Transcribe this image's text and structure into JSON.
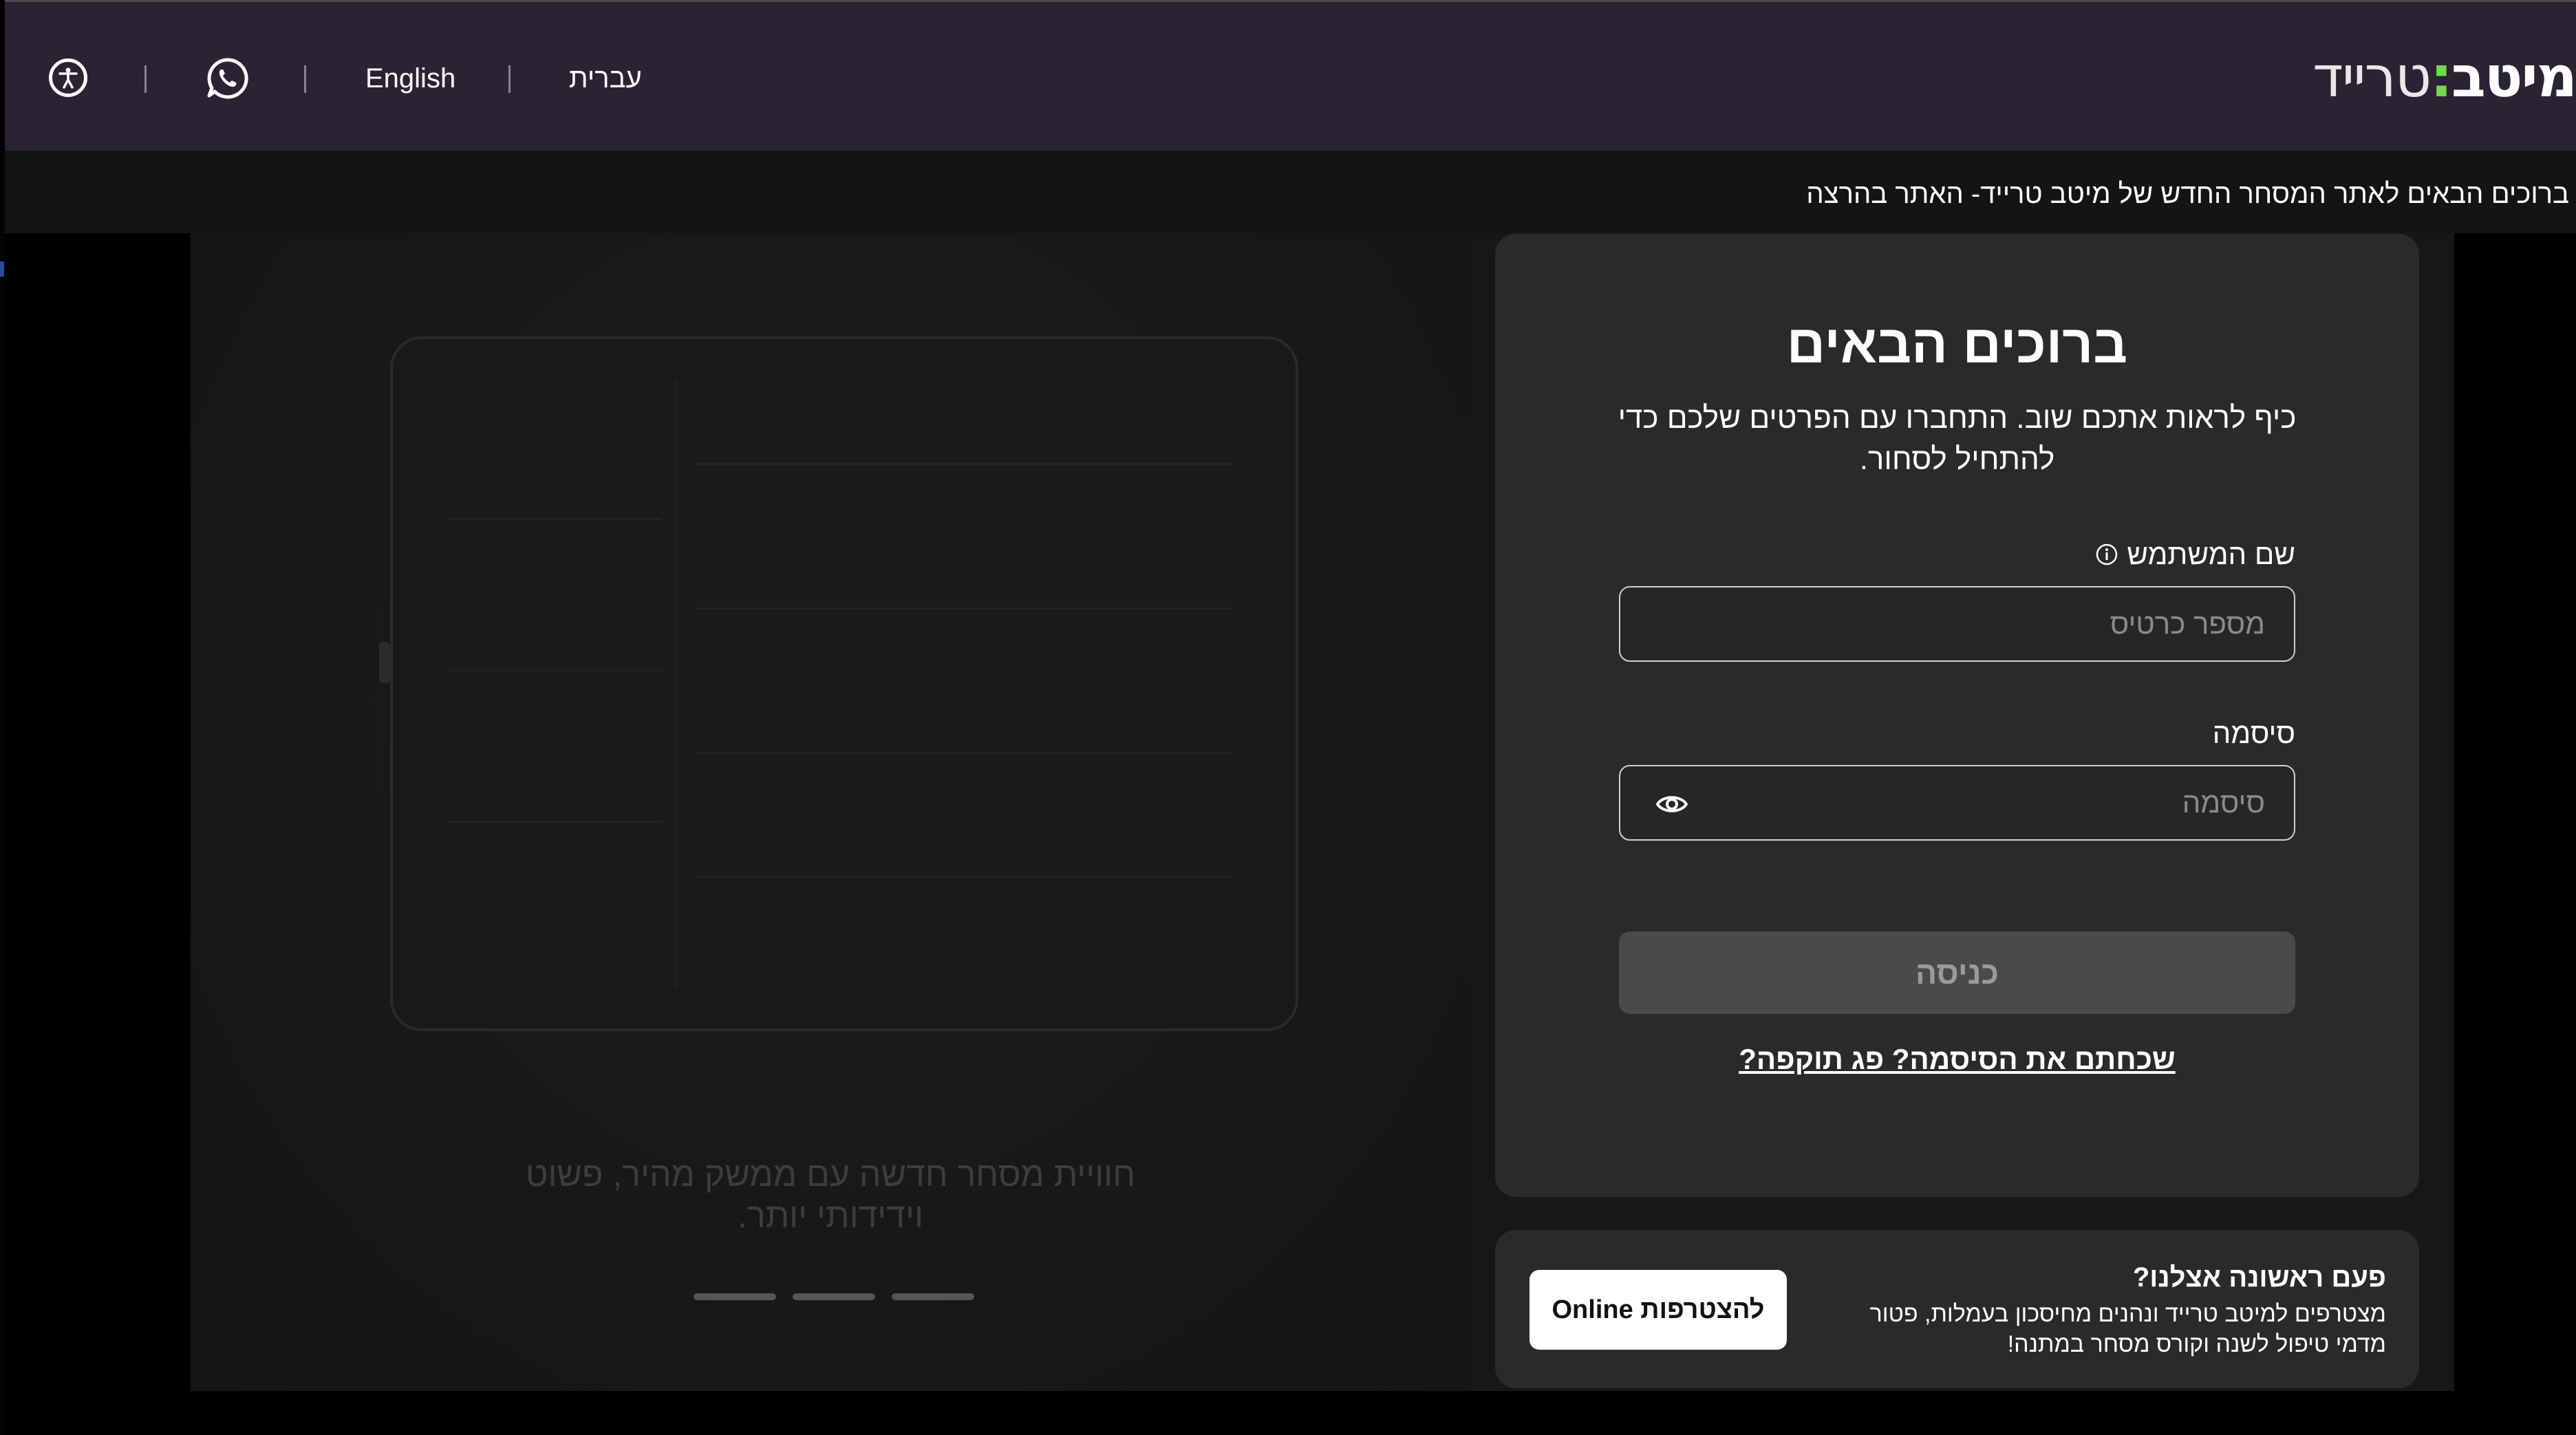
{
  "header": {
    "logo_bold": "מיטב",
    "logo_colon": ":",
    "logo_light": "טרייד",
    "lang_hebrew": "עברית",
    "lang_english": "English",
    "whatsapp_icon": "whatsapp-icon",
    "accessibility_icon": "accessibility-icon"
  },
  "ticker": {
    "text": "ברוכים הבאים לאתר המסחר החדש של מיטב טרייד- האתר בהרצה"
  },
  "hero": {
    "caption": "חוויית מסחר חדשה עם ממשק מהיר, פשוט וידידותי יותר.",
    "slides_count": 3,
    "active_slide": 3
  },
  "login": {
    "title": "ברוכים הבאים",
    "subtitle": "כיף לראות אתכם שוב. התחברו עם הפרטים שלכם כדי להתחיל לסחור.",
    "username_label": "שם המשתמש",
    "username_placeholder": "מספר כרטיס",
    "password_label": "סיסמה",
    "password_placeholder": "סיסמה",
    "submit_label": "כניסה",
    "forgot_link": "שכחתם את הסיסמה? פג תוקפה?"
  },
  "join": {
    "title": "פעם ראשונה אצלנו?",
    "text": "מצטרפים למיטב טרייד ונהנים מחיסכון בעמלות, פטור מדמי טיפול לשנה וקורס מסחר במתנה!",
    "button_label": "להצטרפות Online"
  },
  "colors": {
    "topbar": "#2b2233",
    "accent": "#6ddc4b",
    "card": "#2a2a2a"
  }
}
